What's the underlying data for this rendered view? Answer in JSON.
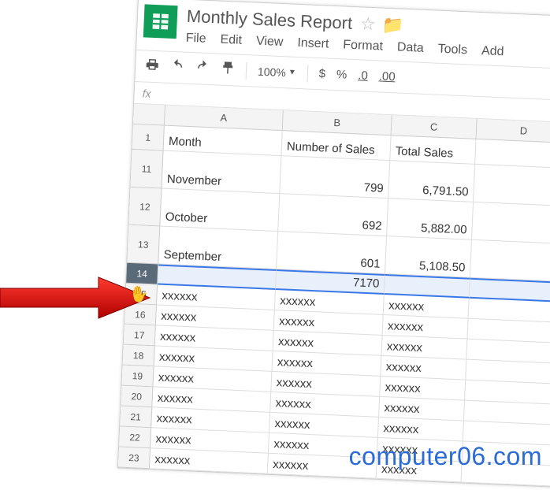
{
  "doc": {
    "title": "Monthly Sales Report"
  },
  "menu": {
    "file": "File",
    "edit": "Edit",
    "view": "View",
    "insert": "Insert",
    "format": "Format",
    "data": "Data",
    "tools": "Tools",
    "add": "Add"
  },
  "toolbar": {
    "zoom": "100%",
    "currency": "$",
    "percent": "%",
    "dec_less": ".0",
    "dec_more": ".00"
  },
  "fx": {
    "label": "fx"
  },
  "cols": {
    "A": "A",
    "B": "B",
    "C": "C",
    "D": "D"
  },
  "rows": {
    "header": {
      "num": "1",
      "A": "Month",
      "B": "Number of Sales",
      "C": "Total Sales",
      "D": ""
    },
    "data": [
      {
        "num": "11",
        "A": "November",
        "B": "799",
        "C": "6,791.50",
        "D": ""
      },
      {
        "num": "12",
        "A": "October",
        "B": "692",
        "C": "5,882.00",
        "D": ""
      },
      {
        "num": "13",
        "A": "September",
        "B": "601",
        "C": "5,108.50",
        "D": ""
      }
    ],
    "selected": {
      "num": "14",
      "A": "",
      "B": "7170",
      "C": "",
      "D": ""
    },
    "filler": [
      {
        "num": "15",
        "A": "xxxxxx",
        "B": "xxxxxx",
        "C": "xxxxxx",
        "D": ""
      },
      {
        "num": "16",
        "A": "xxxxxx",
        "B": "xxxxxx",
        "C": "xxxxxx",
        "D": ""
      },
      {
        "num": "17",
        "A": "xxxxxx",
        "B": "xxxxxx",
        "C": "xxxxxx",
        "D": ""
      },
      {
        "num": "18",
        "A": "xxxxxx",
        "B": "xxxxxx",
        "C": "xxxxxx",
        "D": ""
      },
      {
        "num": "19",
        "A": "xxxxxx",
        "B": "xxxxxx",
        "C": "xxxxxx",
        "D": ""
      },
      {
        "num": "20",
        "A": "xxxxxx",
        "B": "xxxxxx",
        "C": "xxxxxx",
        "D": ""
      },
      {
        "num": "21",
        "A": "xxxxxx",
        "B": "xxxxxx",
        "C": "xxxxxx",
        "D": ""
      },
      {
        "num": "22",
        "A": "xxxxxx",
        "B": "xxxxxx",
        "C": "xxxxxx",
        "D": ""
      },
      {
        "num": "23",
        "A": "xxxxxx",
        "B": "xxxxxx",
        "C": "xxxxxx",
        "D": ""
      }
    ]
  },
  "watermark": "computer06.com"
}
